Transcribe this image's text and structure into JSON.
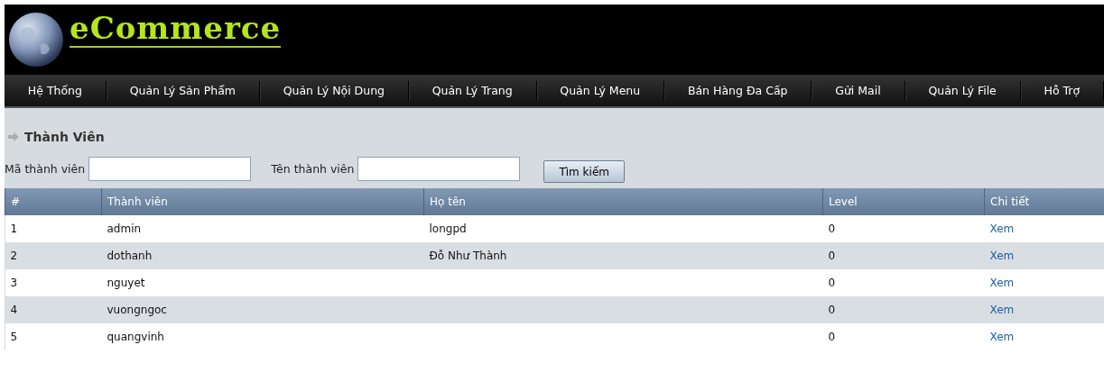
{
  "header": {
    "logo": "eCommerce"
  },
  "nav": [
    "Hệ Thống",
    "Quản Lý Sản Phẩm",
    "Quản Lý Nội Dung",
    "Quản Lý Trang",
    "Quản Lý Menu",
    "Bán Hàng Đa Cấp",
    "Gửi Mail",
    "Quản Lý File",
    "Hỗ Trợ"
  ],
  "section_title": "Thành Viên",
  "search": {
    "fields": [
      {
        "label": "Mã thành viên"
      },
      {
        "label": "Tên thành viên"
      }
    ],
    "button": "Tìm kiếm"
  },
  "table": {
    "columns": [
      "#",
      "Thành viên",
      "Họ tên",
      "Level",
      "Chi tiết"
    ],
    "rows": [
      {
        "cells": [
          "1",
          "admin",
          "longpd",
          "0"
        ],
        "link": "Xem"
      },
      {
        "cells": [
          "2",
          "dothanh",
          "Đỗ Như Thành",
          "0"
        ],
        "link": "Xem"
      },
      {
        "cells": [
          "3",
          "nguyet",
          "",
          "0"
        ],
        "link": "Xem"
      },
      {
        "cells": [
          "4",
          "vuongngoc",
          "",
          "0"
        ],
        "link": "Xem"
      },
      {
        "cells": [
          "5",
          "quangvinh",
          "",
          "0"
        ],
        "link": "Xem"
      }
    ]
  }
}
